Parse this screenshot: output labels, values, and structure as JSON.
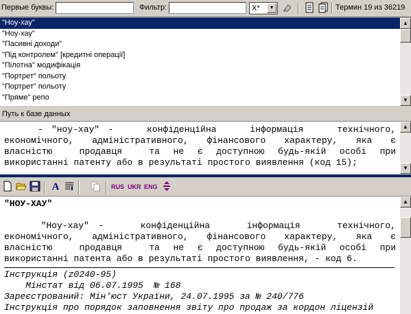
{
  "toolbar": {
    "first_letters_label": "Первые буквы:",
    "first_letters_value": "",
    "filter_label": "Фильтр:",
    "filter_value": "",
    "combo_value": "X*",
    "term_counter": "Термин 19 из 36219"
  },
  "term_list": {
    "items": [
      "\"Ноу-хау\"",
      "\"Ноу-хау\"",
      "\"Пасивні доходи\"",
      "\"Під контролем\" [кредитні операції]",
      "\"Пілотна\" модифікація",
      "\"Портрет\" польоту",
      "\"Портрет\" польоту",
      "\"Пряме\" репо"
    ],
    "selected_index": 0
  },
  "path_bar": {
    "label": "Путь к базе данных"
  },
  "preview": {
    "lines": [
      "    - \"ноу-хау\" -    конфіденційна    інформація    технічного,",
      "економічного, адміністративного, фінансового характеру, яка є",
      "власністю  продавця  та не є доступною будь-якій особі при",
      "використанні патенту або в результаті простого виявлення (код 15);"
    ]
  },
  "doc_toolbar": {
    "rus_label": "RUS",
    "ukr_label": "UKR",
    "eng_label": "ENG"
  },
  "document": {
    "heading": "\"НОУ-ХАУ\"",
    "body_lines": [
      "    \"Ноу-хау\" -    конфіденційна    інформація    технічного,",
      "економічного, адміністративного, фінансового характеру, яка є",
      "власністю  продавця  та не є доступною будь-якій особі при",
      "використанні патента або в результаті простого виявлення, - код 6."
    ],
    "source_lines": [
      "Інструкція (z0240-95)",
      "    Мінстат від 06.07.1995  № 168",
      "Зареєстрований: Мін'юст України, 24.07.1995 за № 240/776",
      "Інструкція про порядок заповнення звіту про продаж за кордон ліцензій"
    ]
  }
}
